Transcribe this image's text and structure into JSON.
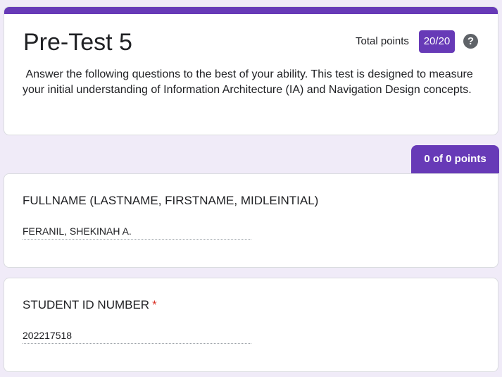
{
  "form": {
    "title": "Pre-Test 5",
    "total_points_label": "Total points",
    "total_points_value": "20/20",
    "description": " Answer the following questions to the best of your ability. This test is designed to measure your initial understanding of Information Architecture (IA) and Navigation Design concepts.",
    "help_icon": "?"
  },
  "section": {
    "points_label": "0 of 0 points"
  },
  "questions": [
    {
      "title": "FULLNAME (LASTNAME, FIRSTNAME, MIDLEINTIAL)",
      "answer": "FERANIL, SHEKINAH A.",
      "required": false
    },
    {
      "title": "STUDENT ID NUMBER",
      "answer": "202217518",
      "required": true,
      "required_mark": "*"
    }
  ],
  "colors": {
    "accent": "#673ab7",
    "background": "#f0ebf8",
    "required": "#d93025"
  }
}
